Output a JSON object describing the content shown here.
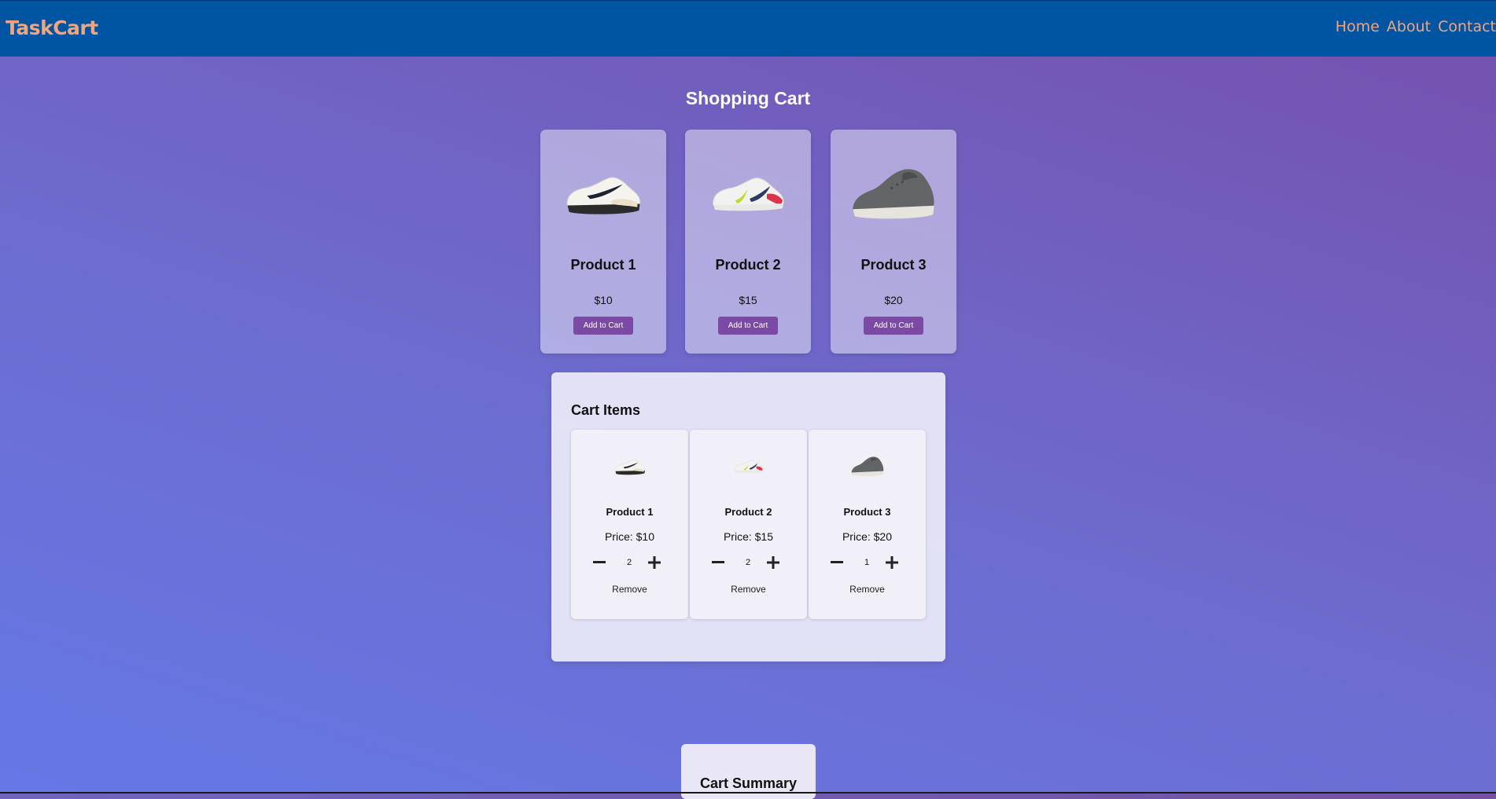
{
  "navbar": {
    "brand": "TaskCart",
    "links": [
      "Home",
      "About",
      "Contact"
    ]
  },
  "page": {
    "title": "Shopping Cart"
  },
  "products": [
    {
      "name": "Product 1",
      "price": "$10",
      "button": "Add to Cart",
      "image": "white-black-sneaker-image"
    },
    {
      "name": "Product 2",
      "price": "$15",
      "button": "Add to Cart",
      "image": "white-neon-sneaker-image"
    },
    {
      "name": "Product 3",
      "price": "$20",
      "button": "Add to Cart",
      "image": "grey-wool-sneaker-image"
    }
  ],
  "cart": {
    "heading": "Cart Items",
    "items": [
      {
        "name": "Product 1",
        "price": "Price: $10",
        "quantity": "2",
        "remove": "Remove"
      },
      {
        "name": "Product 2",
        "price": "Price: $15",
        "quantity": "2",
        "remove": "Remove"
      },
      {
        "name": "Product 3",
        "price": "Price: $20",
        "quantity": "1",
        "remove": "Remove"
      }
    ]
  },
  "summary": {
    "title": "Cart Summary"
  },
  "colors": {
    "navbar": "#0055a3",
    "brand": "#f2a57f",
    "button": "#7b4aa4"
  }
}
